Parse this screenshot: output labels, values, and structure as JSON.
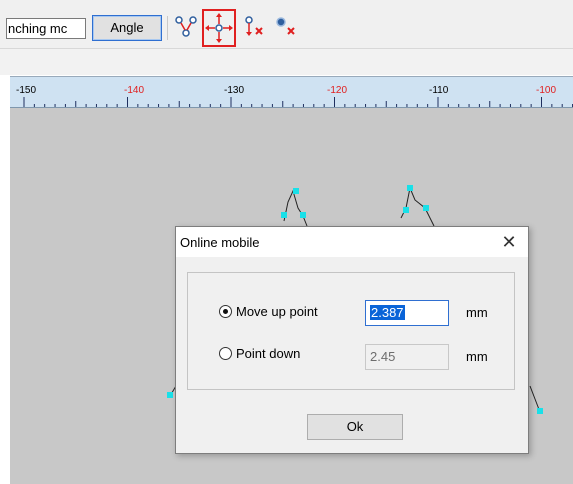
{
  "toolbar": {
    "mode_field_text": "nching mc",
    "angle_button": "Angle",
    "tools": [
      {
        "name": "split-points-icon",
        "selected": false
      },
      {
        "name": "move-point-icon",
        "selected": true
      },
      {
        "name": "delete-point-x-icon",
        "selected": false
      },
      {
        "name": "delete-dot-x-icon",
        "selected": false
      }
    ]
  },
  "ruler": {
    "labels": [
      "-150",
      "-140",
      "-130",
      "-120",
      "-110",
      "-100"
    ],
    "label_colors": [
      "#000000",
      "#e02020",
      "#000000",
      "#e02020",
      "#000000",
      "#e02020"
    ]
  },
  "dialog": {
    "title": "Online mobile",
    "close_glyph": "✕",
    "move_up": {
      "label": "Move up point",
      "value": "2.387",
      "unit": "mm",
      "selected": true
    },
    "point_down": {
      "label": "Point down",
      "value": "2.45",
      "unit": "mm",
      "selected": false
    },
    "ok_label": "Ok"
  },
  "colors": {
    "canvas": "#c8c8c8",
    "point": "#19e0e8",
    "accent": "#2f6fd1",
    "selection_border": "#e02020"
  }
}
